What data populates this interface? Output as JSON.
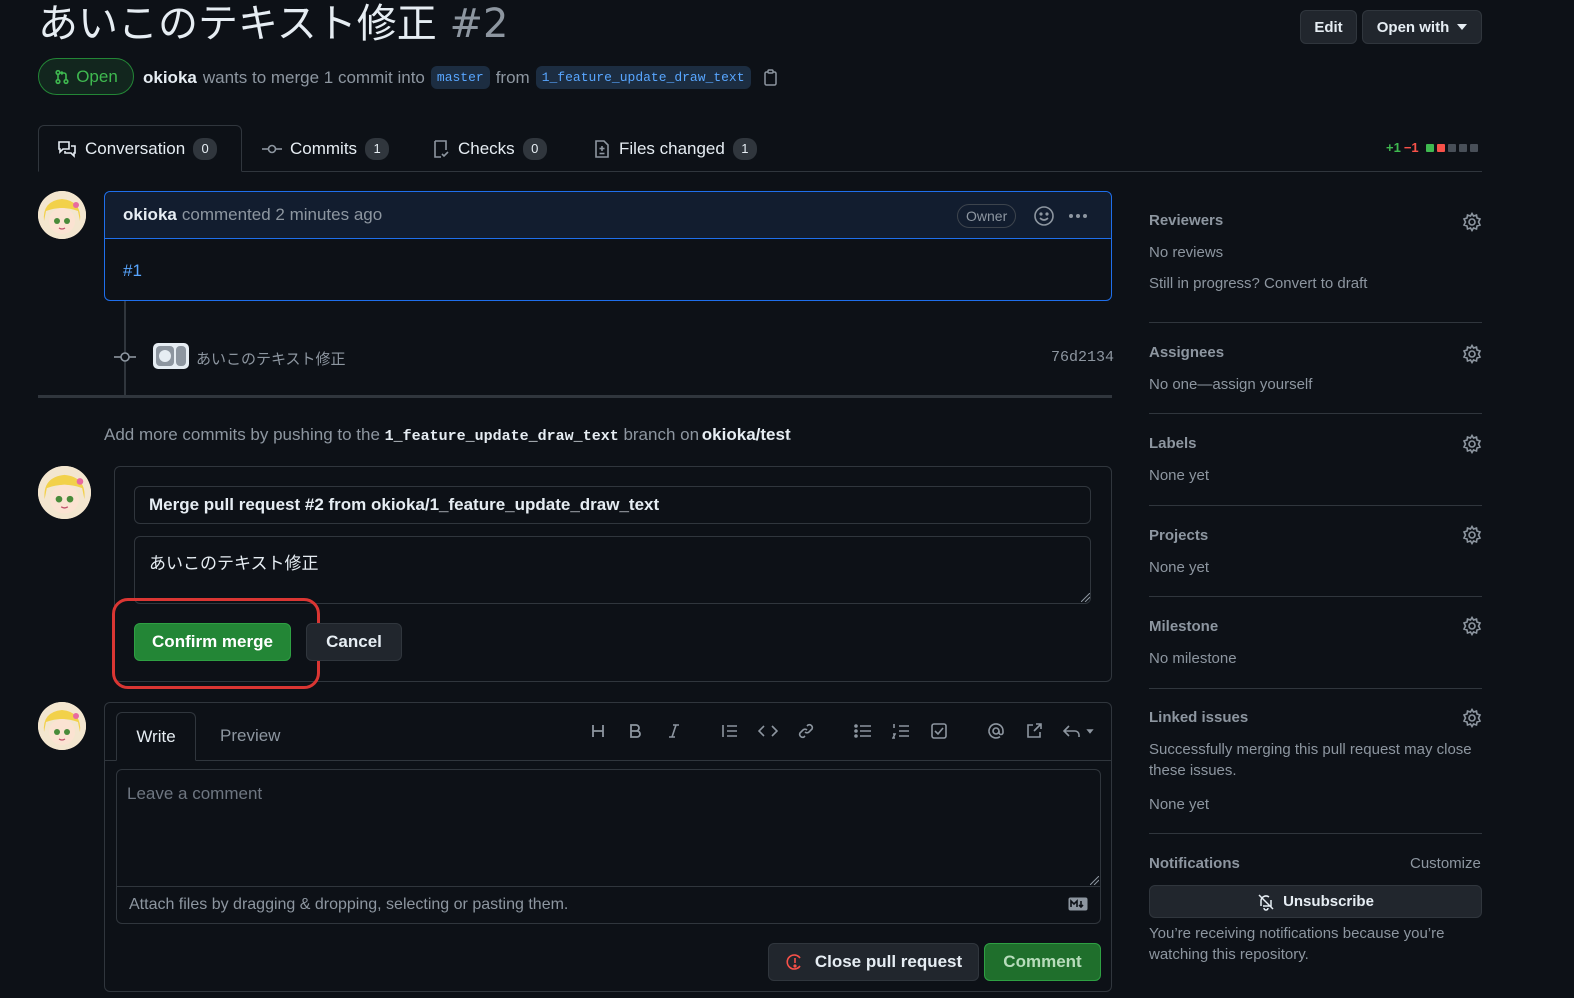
{
  "header": {
    "title": "あいこのテキスト修正",
    "number": "#2",
    "edit_label": "Edit",
    "open_with_label": "Open with",
    "state": "Open",
    "author": "okioka",
    "merge_text": "wants to merge 1 commit into",
    "base_branch": "master",
    "from_text": "from",
    "head_branch": "1_feature_update_draw_text"
  },
  "tabs": [
    {
      "label": "Conversation",
      "count": "0"
    },
    {
      "label": "Commits",
      "count": "1"
    },
    {
      "label": "Checks",
      "count": "0"
    },
    {
      "label": "Files changed",
      "count": "1"
    }
  ],
  "diffstat": {
    "added": "+1",
    "removed": "−1"
  },
  "comment": {
    "author": "okioka",
    "action": "commented 2 minutes ago",
    "badge": "Owner",
    "body": "#1"
  },
  "commit": {
    "message": "あいこのテキスト修正",
    "sha": "76d2134"
  },
  "push_hint": {
    "prefix": "Add more commits by pushing to the",
    "branch": "1_feature_update_draw_text",
    "middle": "branch on",
    "repo": "okioka/test",
    "suffix": "."
  },
  "merge_form": {
    "title_value": "Merge pull request #2 from okioka/1_feature_update_draw_text",
    "body_value": "あいこのテキスト修正",
    "confirm_label": "Confirm merge",
    "cancel_label": "Cancel",
    "highlight_color": "#da3633"
  },
  "new_comment": {
    "write_tab": "Write",
    "preview_tab": "Preview",
    "placeholder": "Leave a comment",
    "attach_hint": "Attach files by dragging & dropping, selecting or pasting them.",
    "close_label": "Close pull request",
    "comment_label": "Comment"
  },
  "sidebar": {
    "reviewers": {
      "heading": "Reviewers",
      "value": "No reviews",
      "draft_hint": "Still in progress? Convert to draft"
    },
    "assignees": {
      "heading": "Assignees",
      "value": "No one—assign yourself"
    },
    "labels": {
      "heading": "Labels",
      "value": "None yet"
    },
    "projects": {
      "heading": "Projects",
      "value": "None yet"
    },
    "milestone": {
      "heading": "Milestone",
      "value": "No milestone"
    },
    "linked_issues": {
      "heading": "Linked issues",
      "description": "Successfully merging this pull request may close these issues.",
      "value": "None yet"
    },
    "notifications": {
      "heading": "Notifications",
      "customize": "Customize",
      "unsubscribe": "Unsubscribe",
      "reason": "You’re receiving notifications because you’re watching this repository."
    }
  },
  "colors": {
    "background": "#0d1117",
    "accent_blue": "#58a6ff",
    "success_green": "#238636",
    "danger_red": "#f85149"
  }
}
